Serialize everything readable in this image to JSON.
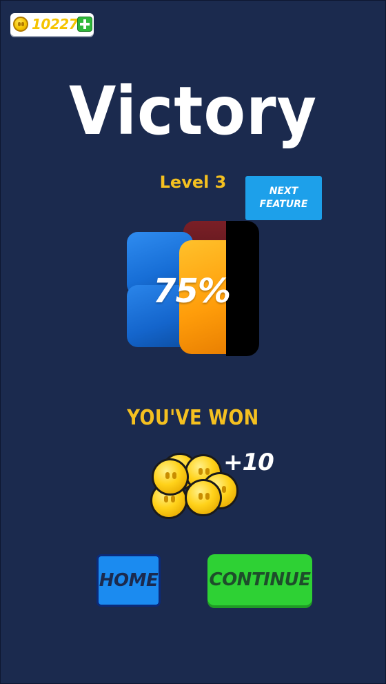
{
  "hud": {
    "coins": "10227",
    "add_coins_icon": "plus-icon"
  },
  "result": {
    "title": "Victory",
    "level": "Level 3",
    "next_feature": "NEXT FEATURE",
    "progress_percent_label": "75%",
    "progress_percent": 75
  },
  "reward": {
    "heading": "YOU'VE WON",
    "amount": "+10",
    "icon": "coin-pile-icon"
  },
  "buttons": {
    "home": "HOME",
    "continue": "CONTINUE"
  },
  "colors": {
    "background": "#1b2a4e",
    "accent_yellow": "#f4c020",
    "home_blue": "#1b8bf0",
    "continue_green": "#2ed134",
    "next_feature_blue": "#1da0ea"
  }
}
